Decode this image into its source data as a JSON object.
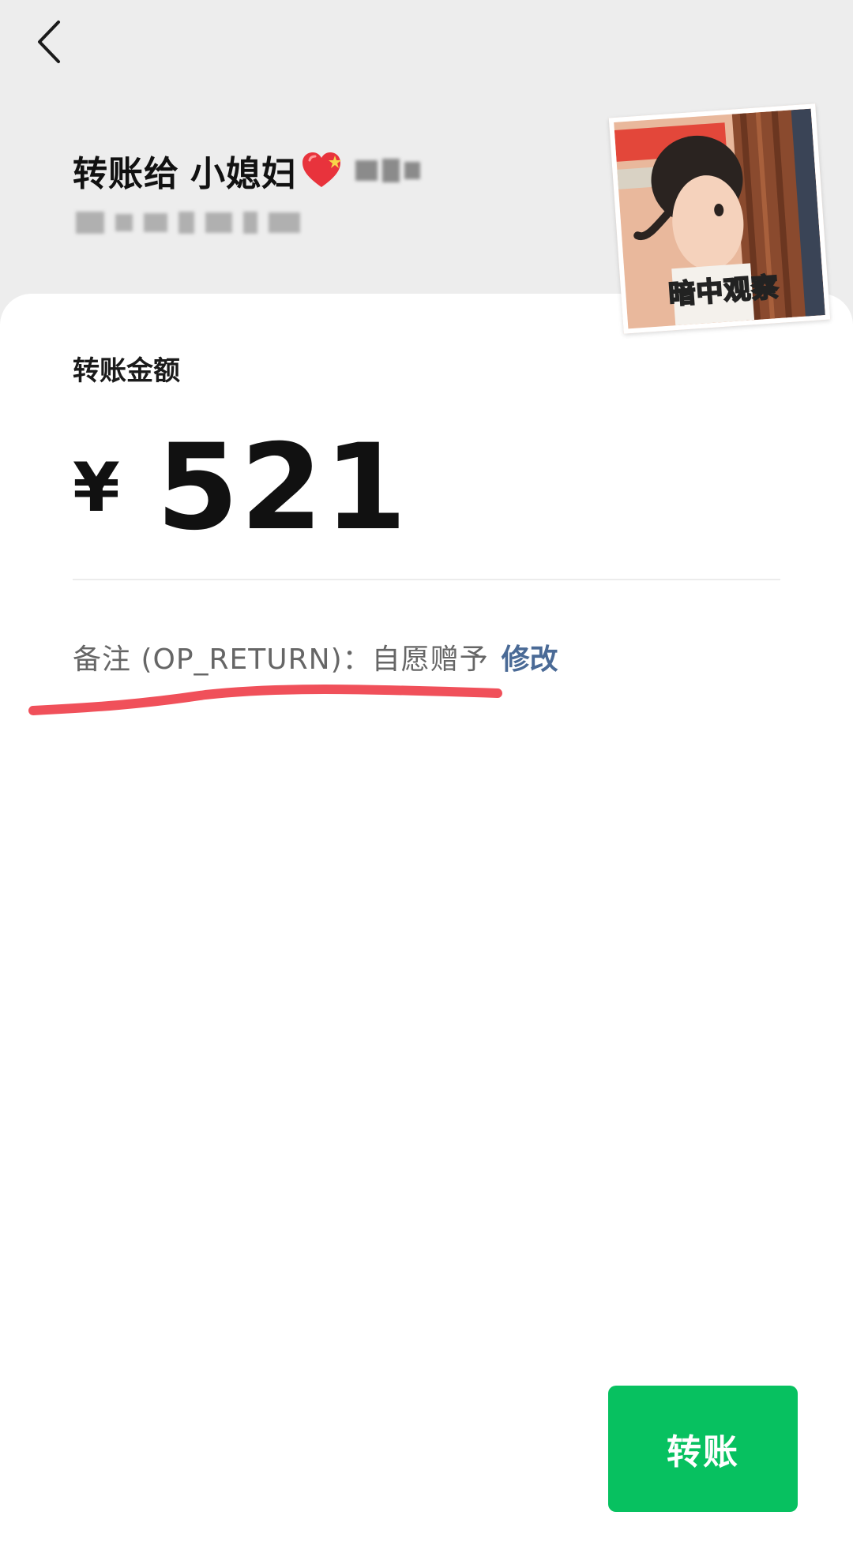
{
  "header": {
    "recipient_prefix": "转账给",
    "recipient_name": "小媳妇"
  },
  "sticker": {
    "caption": "暗中观察"
  },
  "amount": {
    "label": "转账金额",
    "currency": "¥",
    "value": "521"
  },
  "remark": {
    "text": "备注 (OP_RETURN)：自愿赠予",
    "edit_label": "修改"
  },
  "actions": {
    "transfer_label": "转账"
  },
  "colors": {
    "background": "#ededed",
    "card": "#ffffff",
    "accent_green": "#07c160",
    "link_blue": "#4a6a96",
    "annotation_red": "#f0505a"
  },
  "icons": {
    "back": "chevron-left-icon",
    "heart": "heart-icon"
  }
}
